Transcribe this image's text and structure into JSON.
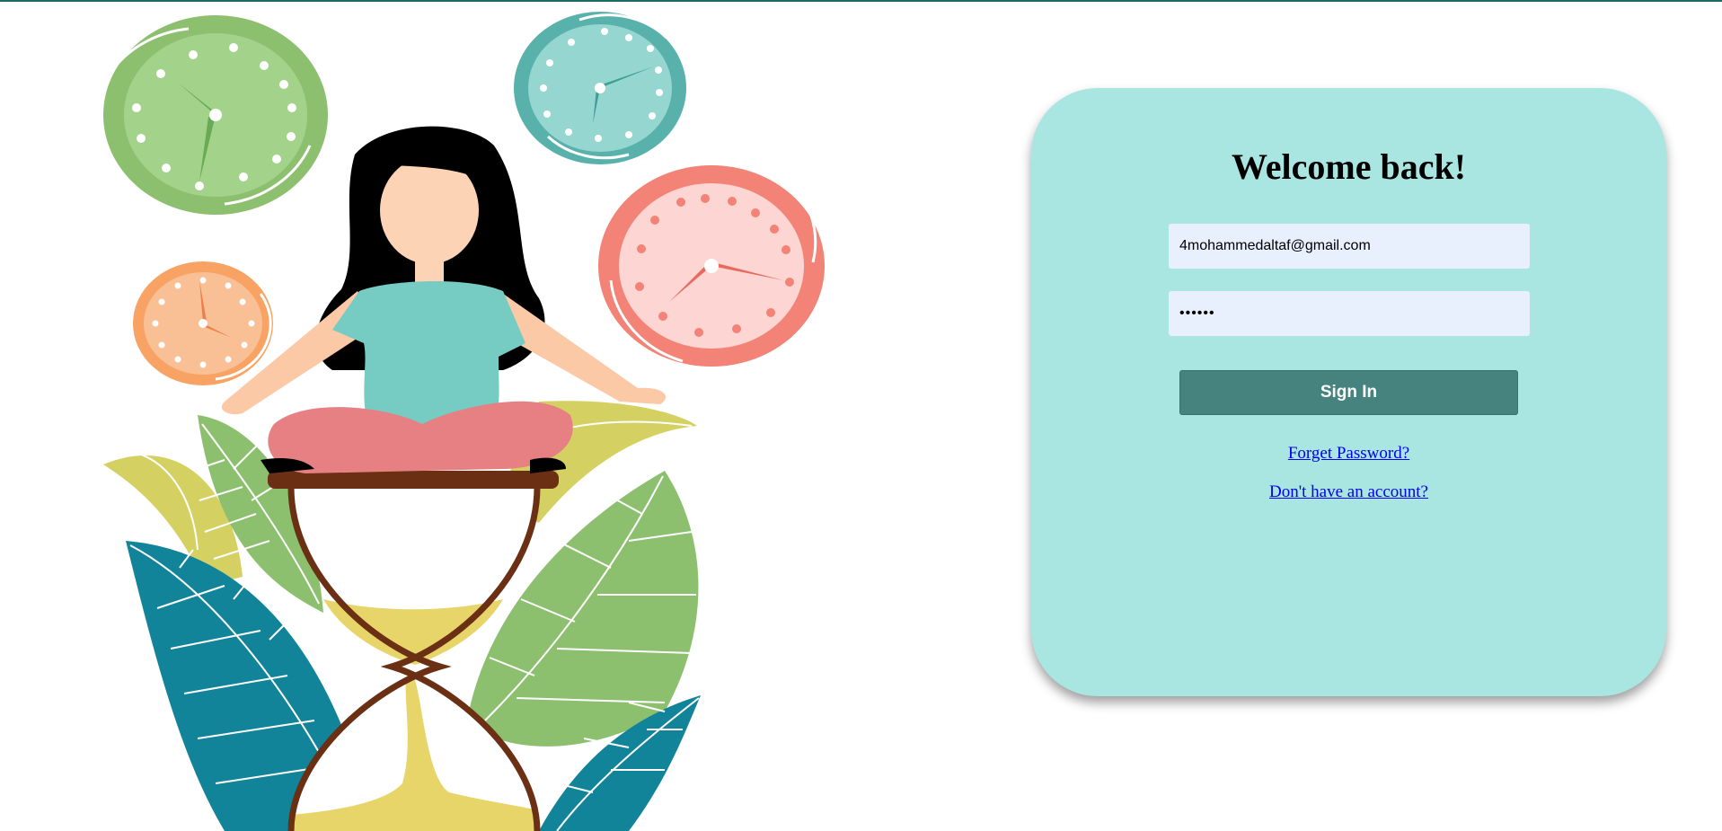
{
  "colors": {
    "card_background": "#a9e5e1",
    "input_background": "#e8f0fe",
    "button_background": "#47837e",
    "button_text": "#ffffff",
    "link": "#0000ee",
    "top_border": "#1f6b66"
  },
  "illustration": {
    "subject": "woman meditating on hourglass surrounded by clocks and leaves"
  },
  "login": {
    "heading": "Welcome back!",
    "email_value": "4mohammedaltaf@gmail.com",
    "password_value": "123456",
    "sign_in_label": "Sign In",
    "forgot_password_label": "Forget Password?",
    "no_account_label": "Don't have an account?"
  }
}
